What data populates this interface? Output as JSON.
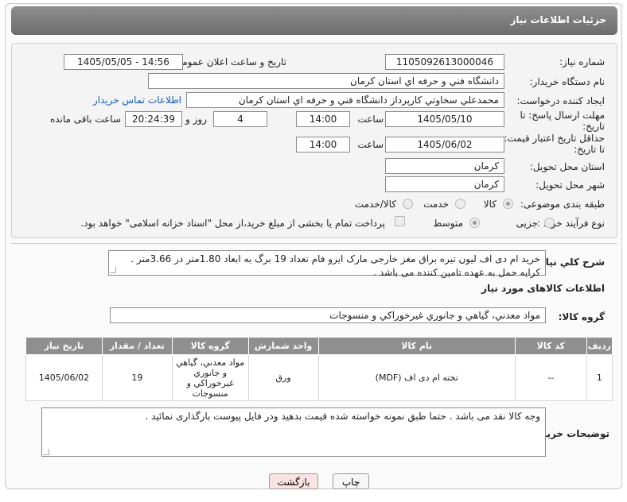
{
  "header": {
    "title": "جزئیات اطلاعات نیاز"
  },
  "form": {
    "need_number": {
      "label": "شماره نیاز:",
      "value": "1105092613000046"
    },
    "announce": {
      "label": "تاریخ و ساعت اعلان عمومی:",
      "value": "1405/05/05 - 14:56"
    },
    "buyer_org": {
      "label": "نام دستگاه خریدار:",
      "value": "دانشگاه فني و حرفه اي استان کرمان"
    },
    "requester": {
      "label": "ایجاد کننده درخواست:",
      "value": "محمدعلي سخاوتي کارپرداز دانشگاه فني و حرفه اي استان کرمان",
      "contact_link": "اطلاعات تماس خریدار"
    },
    "deadline": {
      "label_line1": "مهلت ارسال پاسخ: تا",
      "label_line2": "تاریخ:",
      "date": "1405/05/10",
      "time_label": "ساعت",
      "time": "14:00",
      "days": "4",
      "days_label": "روز و",
      "remaining": "20:24:39",
      "remaining_label": "ساعت باقی مانده"
    },
    "price_validity": {
      "label_line1": "حداقل تاریخ اعتبار قیمت:",
      "label_line2": "تا تاریخ:",
      "date": "1405/06/02",
      "time_label": "ساعت",
      "time": "14:00"
    },
    "delivery_province": {
      "label": "استان محل تحویل:",
      "value": "کرمان"
    },
    "delivery_city": {
      "label": "شهر محل تحویل:",
      "value": "کرمان"
    },
    "category": {
      "label": "طبقه بندی موضوعی:",
      "options": [
        "کالا",
        "خدمت",
        "کالا/خدمت"
      ],
      "selected": "کالا"
    },
    "process": {
      "label": "نوع فرآیند خرید :",
      "options": [
        "جزیی",
        "متوسط"
      ],
      "selected": "متوسط",
      "payment_note": "پرداخت تمام یا بخشی از مبلغ خرید،از محل \"اسناد خزانه اسلامی\" خواهد بود."
    }
  },
  "summary": {
    "label": "شرح کلي نیاز:",
    "text": "خرید ام دی اف لیون تیره براق مغز خارجی مارک ایزو فام تعداد 19 برگ به ابعاد 1.80متر در 3.66متر . کرایه حمل به عهده تامین کننده می باشد ."
  },
  "goods_section": {
    "title": "اطلاعات کالاهای مورد نیاز",
    "group_label": "گروه کالا:",
    "group_value": "مواد معدني، گیاهي و جانوري غیرخوراکي و منسوجات",
    "columns": [
      "ردیف",
      "کد کالا",
      "نام کالا",
      "واحد شمارش",
      "گروه کالا",
      "تعداد / مقدار",
      "تاریخ نیاز"
    ],
    "rows": [
      {
        "index": "1",
        "code": "--",
        "name": "تخته ام دی اف (MDF)",
        "unit": "ورق",
        "group": "مواد معدني، گیاهي و جانوري غیرخوراکي و منسوجات",
        "qty": "19",
        "date": "1405/06/02"
      }
    ]
  },
  "buyer_notes": {
    "label": "توضیحات خریدار:",
    "text": "وجه کالا نقد می باشد . حتما طبق نمونه خواسته شده قیمت بدهید ودر فایل پیوست بارگذاری نمائید ."
  },
  "buttons": {
    "print": "چاپ",
    "back": "بازگشت"
  },
  "colors": {
    "title_bar": "#7a7a7a",
    "link": "#1a5fb4",
    "table_header": "#8f8f8f",
    "back_button_bg": "#fbe3e3"
  }
}
